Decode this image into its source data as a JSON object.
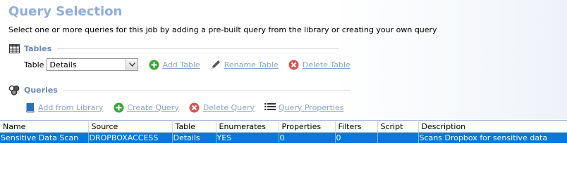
{
  "header": {
    "title": "Query Selection",
    "subtitle": "Select one or more queries for this job by adding a pre-built query from the library or creating your own query"
  },
  "tables_section": {
    "label": "Tables",
    "icon": "table-grid-icon",
    "table_label": "Table",
    "table_value": "Details",
    "actions": {
      "add": "Add Table",
      "rename": "Rename Table",
      "delete": "Delete Table"
    }
  },
  "queries_section": {
    "label": "Queries",
    "icon": "queries-cubes-icon",
    "actions": {
      "add_library": "Add from Library",
      "create": "Create Query",
      "delete": "Delete Query",
      "properties": "Query Properties"
    }
  },
  "grid": {
    "columns": [
      "Name",
      "Source",
      "Table",
      "Enumerates",
      "Properties",
      "Filters",
      "Script",
      "Description"
    ],
    "rows": [
      {
        "name": "Sensitive Data Scan",
        "source": "DROPBOXACCESS",
        "table": "Details",
        "enumerates": "YES",
        "properties": "0",
        "filters": "0",
        "script": "",
        "description": "Scans Dropbox for sensitive data"
      }
    ]
  },
  "colors": {
    "title": "#8eaedb",
    "link": "#8ba3c6",
    "selected_row": "#0a78d7",
    "add_green": "#3aa63a",
    "delete_red": "#d9534f"
  }
}
